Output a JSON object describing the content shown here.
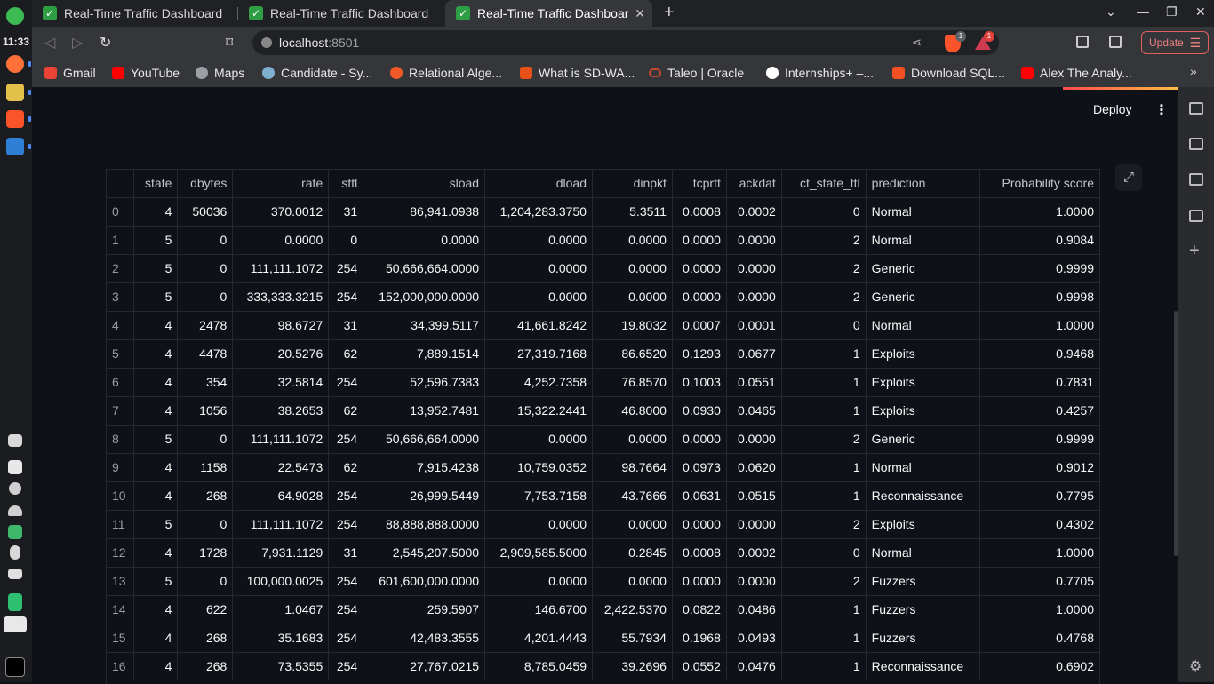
{
  "system": {
    "clock": "11:33"
  },
  "browser": {
    "tabs": [
      {
        "title": "Real-Time Traffic Dashboard",
        "active": false
      },
      {
        "title": "Real-Time Traffic Dashboard",
        "active": false
      },
      {
        "title": "Real-Time Traffic Dashboar",
        "active": true
      }
    ],
    "url_host": "localhost",
    "url_port": ":8501",
    "shield_count": "1",
    "rewards_count": "1",
    "update_label": "Update",
    "bookmarks": [
      {
        "label": "Gmail",
        "color": "#ea4335"
      },
      {
        "label": "YouTube",
        "color": "#ff0000"
      },
      {
        "label": "Maps",
        "color": "#9aa0a6"
      },
      {
        "label": "Candidate - Sy...",
        "color": "#7fb0d0"
      },
      {
        "label": "Relational Alge...",
        "color": "#f05a28"
      },
      {
        "label": "What is SD-WA...",
        "color": "#e8501a"
      },
      {
        "label": "Taleo | Oracle",
        "color": "#c74634"
      },
      {
        "label": "Internships+ –...",
        "color": "#ffffff"
      },
      {
        "label": "Download SQL...",
        "color": "#f25022"
      },
      {
        "label": "Alex The Analy...",
        "color": "#ff0000"
      }
    ]
  },
  "app": {
    "deploy_label": "Deploy",
    "accent": "#ff4b4b"
  },
  "table": {
    "columns": [
      "",
      "state",
      "dbytes",
      "rate",
      "sttl",
      "sload",
      "dload",
      "dinpkt",
      "tcprtt",
      "ackdat",
      "ct_state_ttl",
      "prediction",
      "Probability score"
    ],
    "rows": [
      [
        "0",
        "4",
        "50036",
        "370.0012",
        "31",
        "86,941.0938",
        "1,204,283.3750",
        "5.3511",
        "0.0008",
        "0.0002",
        "0",
        "Normal",
        "1.0000"
      ],
      [
        "1",
        "5",
        "0",
        "0.0000",
        "0",
        "0.0000",
        "0.0000",
        "0.0000",
        "0.0000",
        "0.0000",
        "2",
        "Normal",
        "0.9084"
      ],
      [
        "2",
        "5",
        "0",
        "111,111.1072",
        "254",
        "50,666,664.0000",
        "0.0000",
        "0.0000",
        "0.0000",
        "0.0000",
        "2",
        "Generic",
        "0.9999"
      ],
      [
        "3",
        "5",
        "0",
        "333,333.3215",
        "254",
        "152,000,000.0000",
        "0.0000",
        "0.0000",
        "0.0000",
        "0.0000",
        "2",
        "Generic",
        "0.9998"
      ],
      [
        "4",
        "4",
        "2478",
        "98.6727",
        "31",
        "34,399.5117",
        "41,661.8242",
        "19.8032",
        "0.0007",
        "0.0001",
        "0",
        "Normal",
        "1.0000"
      ],
      [
        "5",
        "4",
        "4478",
        "20.5276",
        "62",
        "7,889.1514",
        "27,319.7168",
        "86.6520",
        "0.1293",
        "0.0677",
        "1",
        "Exploits",
        "0.9468"
      ],
      [
        "6",
        "4",
        "354",
        "32.5814",
        "254",
        "52,596.7383",
        "4,252.7358",
        "76.8570",
        "0.1003",
        "0.0551",
        "1",
        "Exploits",
        "0.7831"
      ],
      [
        "7",
        "4",
        "1056",
        "38.2653",
        "62",
        "13,952.7481",
        "15,322.2441",
        "46.8000",
        "0.0930",
        "0.0465",
        "1",
        "Exploits",
        "0.4257"
      ],
      [
        "8",
        "5",
        "0",
        "111,111.1072",
        "254",
        "50,666,664.0000",
        "0.0000",
        "0.0000",
        "0.0000",
        "0.0000",
        "2",
        "Generic",
        "0.9999"
      ],
      [
        "9",
        "4",
        "1158",
        "22.5473",
        "62",
        "7,915.4238",
        "10,759.0352",
        "98.7664",
        "0.0973",
        "0.0620",
        "1",
        "Normal",
        "0.9012"
      ],
      [
        "10",
        "4",
        "268",
        "64.9028",
        "254",
        "26,999.5449",
        "7,753.7158",
        "43.7666",
        "0.0631",
        "0.0515",
        "1",
        "Reconnaissance",
        "0.7795"
      ],
      [
        "11",
        "5",
        "0",
        "111,111.1072",
        "254",
        "88,888,888.0000",
        "0.0000",
        "0.0000",
        "0.0000",
        "0.0000",
        "2",
        "Exploits",
        "0.4302"
      ],
      [
        "12",
        "4",
        "1728",
        "7,931.1129",
        "31",
        "2,545,207.5000",
        "2,909,585.5000",
        "0.2845",
        "0.0008",
        "0.0002",
        "0",
        "Normal",
        "1.0000"
      ],
      [
        "13",
        "5",
        "0",
        "100,000.0025",
        "254",
        "601,600,000.0000",
        "0.0000",
        "0.0000",
        "0.0000",
        "0.0000",
        "2",
        "Fuzzers",
        "0.7705"
      ],
      [
        "14",
        "4",
        "622",
        "1.0467",
        "254",
        "259.5907",
        "146.6700",
        "2,422.5370",
        "0.0822",
        "0.0486",
        "1",
        "Fuzzers",
        "1.0000"
      ],
      [
        "15",
        "4",
        "268",
        "35.1683",
        "254",
        "42,483.3555",
        "4,201.4443",
        "55.7934",
        "0.1968",
        "0.0493",
        "1",
        "Fuzzers",
        "0.4768"
      ],
      [
        "16",
        "4",
        "268",
        "73.5355",
        "254",
        "27,767.0215",
        "8,785.0459",
        "39.2696",
        "0.0552",
        "0.0476",
        "1",
        "Reconnaissance",
        "0.6902"
      ]
    ]
  }
}
